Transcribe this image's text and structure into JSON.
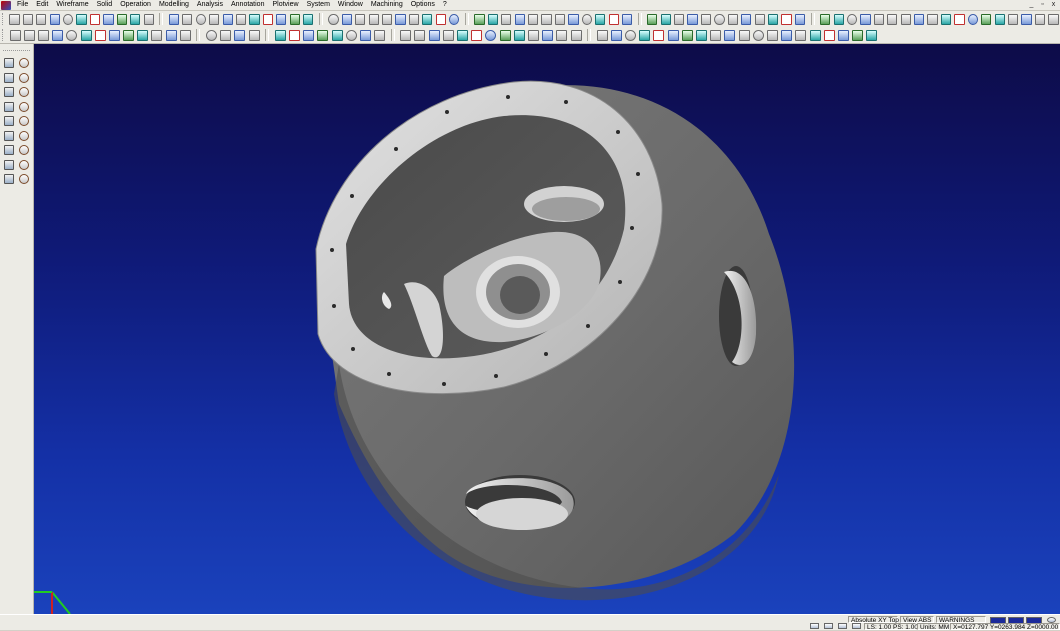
{
  "menubar": {
    "items": [
      "File",
      "Edit",
      "Wireframe",
      "Solid",
      "Operation",
      "Modelling",
      "Analysis",
      "Annotation",
      "Plotview",
      "System",
      "Window",
      "Machining",
      "Options",
      "?"
    ],
    "window_controls": [
      "_",
      "▫",
      "x"
    ]
  },
  "toolbar": {
    "row1_icon_count": 74,
    "row2_icon_count": 58
  },
  "left_toolbar": {
    "rows": 9
  },
  "viewport": {
    "background_top": "#0d0b48",
    "background_bottom": "#1a42bc",
    "model_color": "#6a6a6a",
    "flange_color": "#c8c8c8",
    "triad": {
      "x_axis_color": "#22cc22",
      "y_axis_color": "#d02020",
      "z_axis_color": "#22cc22"
    }
  },
  "statusbar": {
    "view_label": "Absolute XY Top",
    "view_mode": "View ABS",
    "warnings_label": "WARNINGS",
    "scale_text": "LS: 1.00 PS: 1.00",
    "units_text": "Units: MM",
    "coords_text": "X=0127.797 Y=0263.984 Z=0000.00"
  }
}
